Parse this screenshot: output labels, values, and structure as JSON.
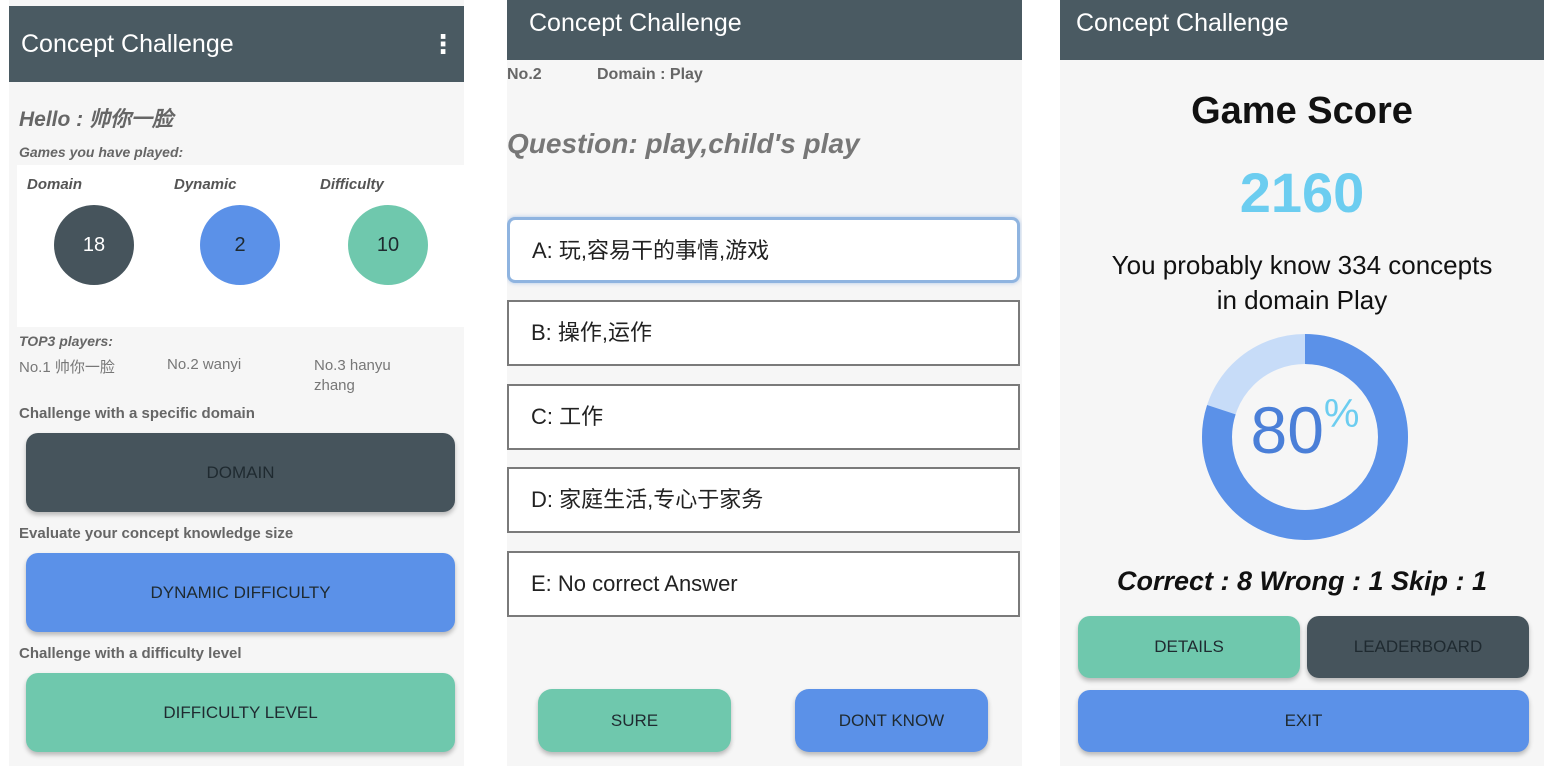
{
  "home": {
    "title": "Concept Challenge",
    "greeting": "Hello : 帅你一脸",
    "games_played_label": "Games you have played:",
    "stats": [
      {
        "label": "Domain",
        "value": "18",
        "color": "#46545c"
      },
      {
        "label": "Dynamic",
        "value": "2",
        "color": "#5b91e8"
      },
      {
        "label": "Difficulty",
        "value": "10",
        "color": "#6fc8ad"
      }
    ],
    "top3_label": "TOP3 players:",
    "top3": [
      "No.1 帅你一脸",
      "No.2 wanyi",
      "No.3 hanyu zhang"
    ],
    "sections": [
      {
        "caption": "Challenge with a specific domain",
        "button": "DOMAIN",
        "color": "#46545c"
      },
      {
        "caption": "Evaluate your concept knowledge size",
        "button": "DYNAMIC DIFFICULTY",
        "color": "#5b91e8"
      },
      {
        "caption": "Challenge with a difficulty level",
        "button": "DIFFICULTY LEVEL",
        "color": "#6fc8ad"
      }
    ]
  },
  "quiz": {
    "title": "Concept Challenge",
    "number": "No.2",
    "domain": "Domain : Play",
    "question": "Question: play,child's play",
    "options": [
      "A: 玩,容易干的事情,游戏",
      "B: 操作,运作",
      "C: 工作",
      "D: 家庭生活,专心于家务",
      "E: No correct Answer"
    ],
    "sure_label": "SURE",
    "dont_know_label": "DONT KNOW"
  },
  "score": {
    "title": "Concept Challenge",
    "heading": "Game Score",
    "score": "2160",
    "message_line1": "You probably know 334 concepts",
    "message_line2": "in domain Play",
    "percent_value": 80,
    "percent_text": "80",
    "percent_sign": "%",
    "summary": "Correct : 8 Wrong : 1 Skip : 1",
    "details_label": "DETAILS",
    "leaderboard_label": "LEADERBOARD",
    "exit_label": "EXIT"
  },
  "colors": {
    "appbar": "#4a5a62",
    "blue": "#5b91e8",
    "green": "#6fc8ad",
    "dark": "#46545c",
    "score_text": "#6ccdf0",
    "ring_light": "#c7dcf8"
  }
}
